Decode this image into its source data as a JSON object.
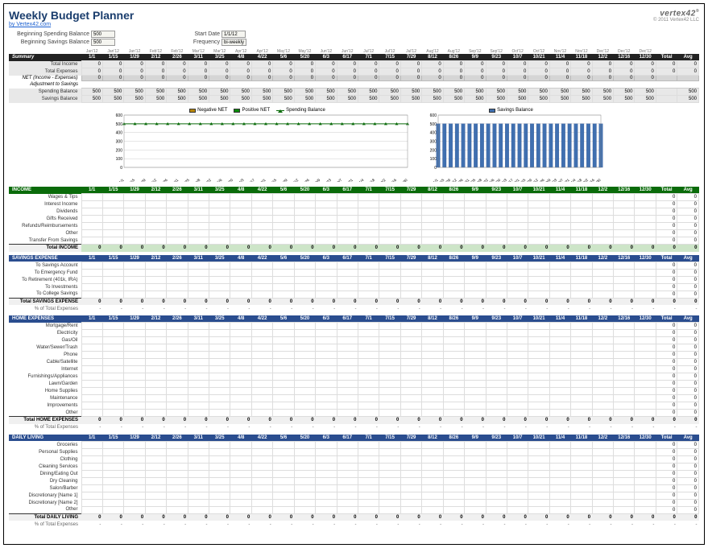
{
  "title": "Weekly Budget Planner",
  "link": "by Vertex42.com",
  "brand": "vertex42",
  "copyright": "© 2011 Vertex42 LLC",
  "inputs": {
    "spending_label": "Beginning Spending Balance",
    "spending_value": "500",
    "savings_label": "Beginning Savings Balance",
    "savings_value": "500",
    "start_label": "Start Date",
    "start_value": "1/1/12",
    "freq_label": "Frequency",
    "freq_value": "bi-weekly"
  },
  "months": [
    "",
    "Jan'12",
    "Jan'12",
    "Jan'12",
    "Feb'12",
    "Feb'12",
    "Mar'12",
    "Mar'12",
    "Apr'12",
    "Apr'12",
    "May'12",
    "May'12",
    "Jun'12",
    "Jun'12",
    "Jul'12",
    "Jul'12",
    "Jul'12",
    "Aug'12",
    "Aug'12",
    "Sep'12",
    "Sep'12",
    "Oct'12",
    "Oct'12",
    "Nov'12",
    "Nov'12",
    "Dec'12",
    "Dec'12",
    "Dec'12",
    "",
    ""
  ],
  "dates": [
    "1/1",
    "1/15",
    "1/29",
    "2/12",
    "2/26",
    "3/11",
    "3/25",
    "4/8",
    "4/22",
    "5/6",
    "5/20",
    "6/3",
    "6/17",
    "7/1",
    "7/15",
    "7/29",
    "8/12",
    "8/26",
    "9/9",
    "9/23",
    "10/7",
    "10/21",
    "11/4",
    "11/18",
    "12/2",
    "12/16",
    "12/30",
    "Total",
    "Avg"
  ],
  "summary": {
    "title": "Summary",
    "rows": [
      {
        "label": "Total Income",
        "vals": [
          "0",
          "0",
          "0",
          "0",
          "0",
          "0",
          "0",
          "0",
          "0",
          "0",
          "0",
          "0",
          "0",
          "0",
          "0",
          "0",
          "0",
          "0",
          "0",
          "0",
          "0",
          "0",
          "0",
          "0",
          "0",
          "0",
          "0",
          "0",
          "0"
        ]
      },
      {
        "label": "Total Expenses",
        "vals": [
          "0",
          "0",
          "0",
          "0",
          "0",
          "0",
          "0",
          "0",
          "0",
          "0",
          "0",
          "0",
          "0",
          "0",
          "0",
          "0",
          "0",
          "0",
          "0",
          "0",
          "0",
          "0",
          "0",
          "0",
          "0",
          "0",
          "0",
          "0",
          "0"
        ]
      }
    ],
    "net_label": "NET (Income - Expenses)",
    "net_vals": [
      "0",
      "0",
      "0",
      "0",
      "0",
      "0",
      "0",
      "0",
      "0",
      "0",
      "0",
      "0",
      "0",
      "0",
      "0",
      "0",
      "0",
      "0",
      "0",
      "0",
      "0",
      "0",
      "0",
      "0",
      "0",
      "0",
      "0",
      "",
      ""
    ],
    "adj_label": "Adjustment to Savings",
    "adj_vals": [
      "",
      "",
      "",
      "",
      "",
      "",
      "",
      "",
      "",
      "",
      "",
      "",
      "",
      "",
      "",
      "",
      "",
      "",
      "",
      "",
      "",
      "",
      "",
      "",
      "",
      "",
      "",
      "",
      ""
    ],
    "spend_label": "Spending Balance",
    "spend_vals": [
      "500",
      "500",
      "500",
      "500",
      "500",
      "500",
      "500",
      "500",
      "500",
      "500",
      "500",
      "500",
      "500",
      "500",
      "500",
      "500",
      "500",
      "500",
      "500",
      "500",
      "500",
      "500",
      "500",
      "500",
      "500",
      "500",
      "500",
      "",
      "500"
    ],
    "save_label": "Savings Balance",
    "save_vals": [
      "500",
      "500",
      "500",
      "500",
      "500",
      "500",
      "500",
      "500",
      "500",
      "500",
      "500",
      "500",
      "500",
      "500",
      "500",
      "500",
      "500",
      "500",
      "500",
      "500",
      "500",
      "500",
      "500",
      "500",
      "500",
      "500",
      "500",
      "",
      "500"
    ]
  },
  "chart_data": [
    {
      "type": "line",
      "legend": [
        {
          "name": "Negative NET",
          "color": "#b8860b",
          "style": "box"
        },
        {
          "name": "Positive NET",
          "color": "#0a8b0a",
          "style": "box"
        },
        {
          "name": "Spending Balance",
          "color": "#0a6b0a",
          "style": "line"
        }
      ],
      "ylim": [
        0,
        600
      ],
      "yticks": [
        0,
        100,
        200,
        300,
        400,
        500,
        600
      ],
      "x": [
        "1/1",
        "1/15",
        "1/29",
        "2/12",
        "2/26",
        "3/11",
        "3/25",
        "4/8",
        "4/22",
        "5/6",
        "5/20",
        "6/3",
        "6/17",
        "7/1",
        "7/15",
        "7/29",
        "8/12",
        "8/26",
        "9/9",
        "9/23",
        "10/7",
        "10/21",
        "11/4",
        "11/18",
        "12/2",
        "12/16",
        "12/30"
      ],
      "series": [
        {
          "name": "Spending Balance",
          "values": [
            500,
            500,
            500,
            500,
            500,
            500,
            500,
            500,
            500,
            500,
            500,
            500,
            500,
            500,
            500,
            500,
            500,
            500,
            500,
            500,
            500,
            500,
            500,
            500,
            500,
            500,
            500
          ]
        }
      ]
    },
    {
      "type": "bar",
      "legend": [
        {
          "name": "Savings Balance",
          "color": "#4070b0",
          "style": "box"
        }
      ],
      "ylim": [
        0,
        600
      ],
      "yticks": [
        0,
        100,
        200,
        300,
        400,
        500,
        600
      ],
      "x": [
        "1/1",
        "1/15",
        "1/29",
        "2/12",
        "2/26",
        "3/11",
        "3/25",
        "4/8",
        "4/22",
        "5/6",
        "5/20",
        "6/3",
        "6/17",
        "7/1",
        "7/15",
        "7/29",
        "8/12",
        "8/26",
        "9/9",
        "9/23",
        "10/7",
        "10/21",
        "11/4",
        "11/18",
        "12/2",
        "12/16",
        "12/30"
      ],
      "values": [
        500,
        500,
        500,
        500,
        500,
        500,
        500,
        500,
        500,
        500,
        500,
        500,
        500,
        500,
        500,
        500,
        500,
        500,
        500,
        500,
        500,
        500,
        500,
        500,
        500,
        500,
        500
      ]
    }
  ],
  "sections": [
    {
      "title": "INCOME",
      "color": "income",
      "rows": [
        "Wages & Tips",
        "Interest Income",
        "Dividends",
        "Gifts Received",
        "Refunds/Reimbursements",
        "Other",
        "Transfer From Savings"
      ],
      "total": "Total INCOME",
      "subtotal": null,
      "total_bg": "#cde5c8"
    },
    {
      "title": "SAVINGS EXPENSE",
      "color": "blue",
      "rows": [
        "To Savings Account",
        "To Emergency Fund",
        "To Retirement (401k, IRA)",
        "To Investments",
        "To College Savings"
      ],
      "total": "Total SAVINGS EXPENSE",
      "subtotal": "% of Total Expenses"
    },
    {
      "title": "HOME EXPENSES",
      "color": "blue",
      "rows": [
        "Mortgage/Rent",
        "Electricity",
        "Gas/Oil",
        "Water/Sewer/Trash",
        "Phone",
        "Cable/Satellite",
        "Internet",
        "Furnishings/Appliances",
        "Lawn/Garden",
        "Home Supplies",
        "Maintenance",
        "Improvements",
        "Other"
      ],
      "total": "Total HOME EXPENSES",
      "subtotal": "% of Total Expenses"
    },
    {
      "title": "DAILY LIVING",
      "color": "blue",
      "rows": [
        "Groceries",
        "Personal Supplies",
        "Clothing",
        "Cleaning Services",
        "Dining/Eating Out",
        "Dry Cleaning",
        "Salon/Barber",
        "Discretionary [Name 1]",
        "Discretionary [Name 2]",
        "Other"
      ],
      "total": "Total DAILY LIVING",
      "subtotal": "% of Total Expenses"
    }
  ]
}
